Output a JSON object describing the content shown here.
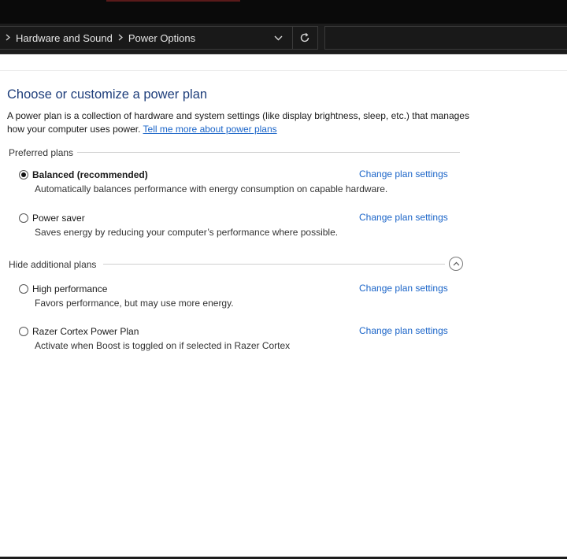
{
  "breadcrumb": {
    "items": [
      "Hardware and Sound",
      "Power Options"
    ]
  },
  "icons": {
    "breadcrumb_separator": "chevron-right-icon",
    "address_dropdown": "chevron-down-icon",
    "refresh": "refresh-icon",
    "collapse": "chevron-up-icon"
  },
  "main": {
    "title": "Choose or customize a power plan",
    "description": "A power plan is a collection of hardware and system settings (like display brightness, sleep, etc.) that manages how your computer uses power.",
    "learn_more_link": "Tell me more about power plans"
  },
  "preferred_plans": {
    "heading": "Preferred plans",
    "plans": [
      {
        "name": "Balanced (recommended)",
        "selected": true,
        "description": "Automatically balances performance with energy consumption on capable hardware.",
        "link": "Change plan settings"
      },
      {
        "name": "Power saver",
        "selected": false,
        "description": "Saves energy by reducing your computer’s performance where possible.",
        "link": "Change plan settings"
      }
    ]
  },
  "additional_plans": {
    "heading": "Hide additional plans",
    "plans": [
      {
        "name": "High performance",
        "selected": false,
        "description": "Favors performance, but may use more energy.",
        "link": "Change plan settings"
      },
      {
        "name": "Razer Cortex Power Plan",
        "selected": false,
        "description": "Activate when Boost is toggled on if selected in Razer Cortex",
        "link": "Change plan settings"
      }
    ]
  },
  "colors": {
    "title_blue": "#1e3e7b",
    "link_blue": "#1a64c8",
    "toolbar_dark": "#1c1c1c"
  }
}
